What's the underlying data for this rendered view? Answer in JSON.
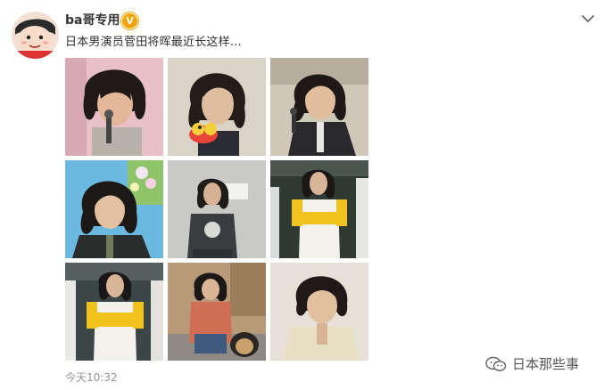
{
  "post": {
    "username": "ba哥专用",
    "verified_badge": "V",
    "text": "日本男演员菅田将晖最近长这样…",
    "timestamp": "今天10:32"
  },
  "icons": {
    "menu": "chevron-down-icon",
    "watermark": "wechat-icon"
  },
  "photos": [
    {
      "label": "photo-1",
      "bg": "#e9bfc8"
    },
    {
      "label": "photo-2",
      "bg": "#d9d3c8"
    },
    {
      "label": "photo-3",
      "bg": "#cfc7b8"
    },
    {
      "label": "photo-4",
      "bg": "#6bb9e0"
    },
    {
      "label": "photo-5",
      "bg": "#c9c9c7"
    },
    {
      "label": "photo-6",
      "bg": "#2f3a35"
    },
    {
      "label": "photo-7",
      "bg": "#3b4647"
    },
    {
      "label": "photo-8",
      "bg": "#b89a78"
    },
    {
      "label": "photo-9",
      "bg": "#e6e0d6"
    }
  ],
  "watermark": {
    "text": "日本那些事"
  },
  "colors": {
    "badge": "#f4a400",
    "timestamp": "#939393"
  }
}
